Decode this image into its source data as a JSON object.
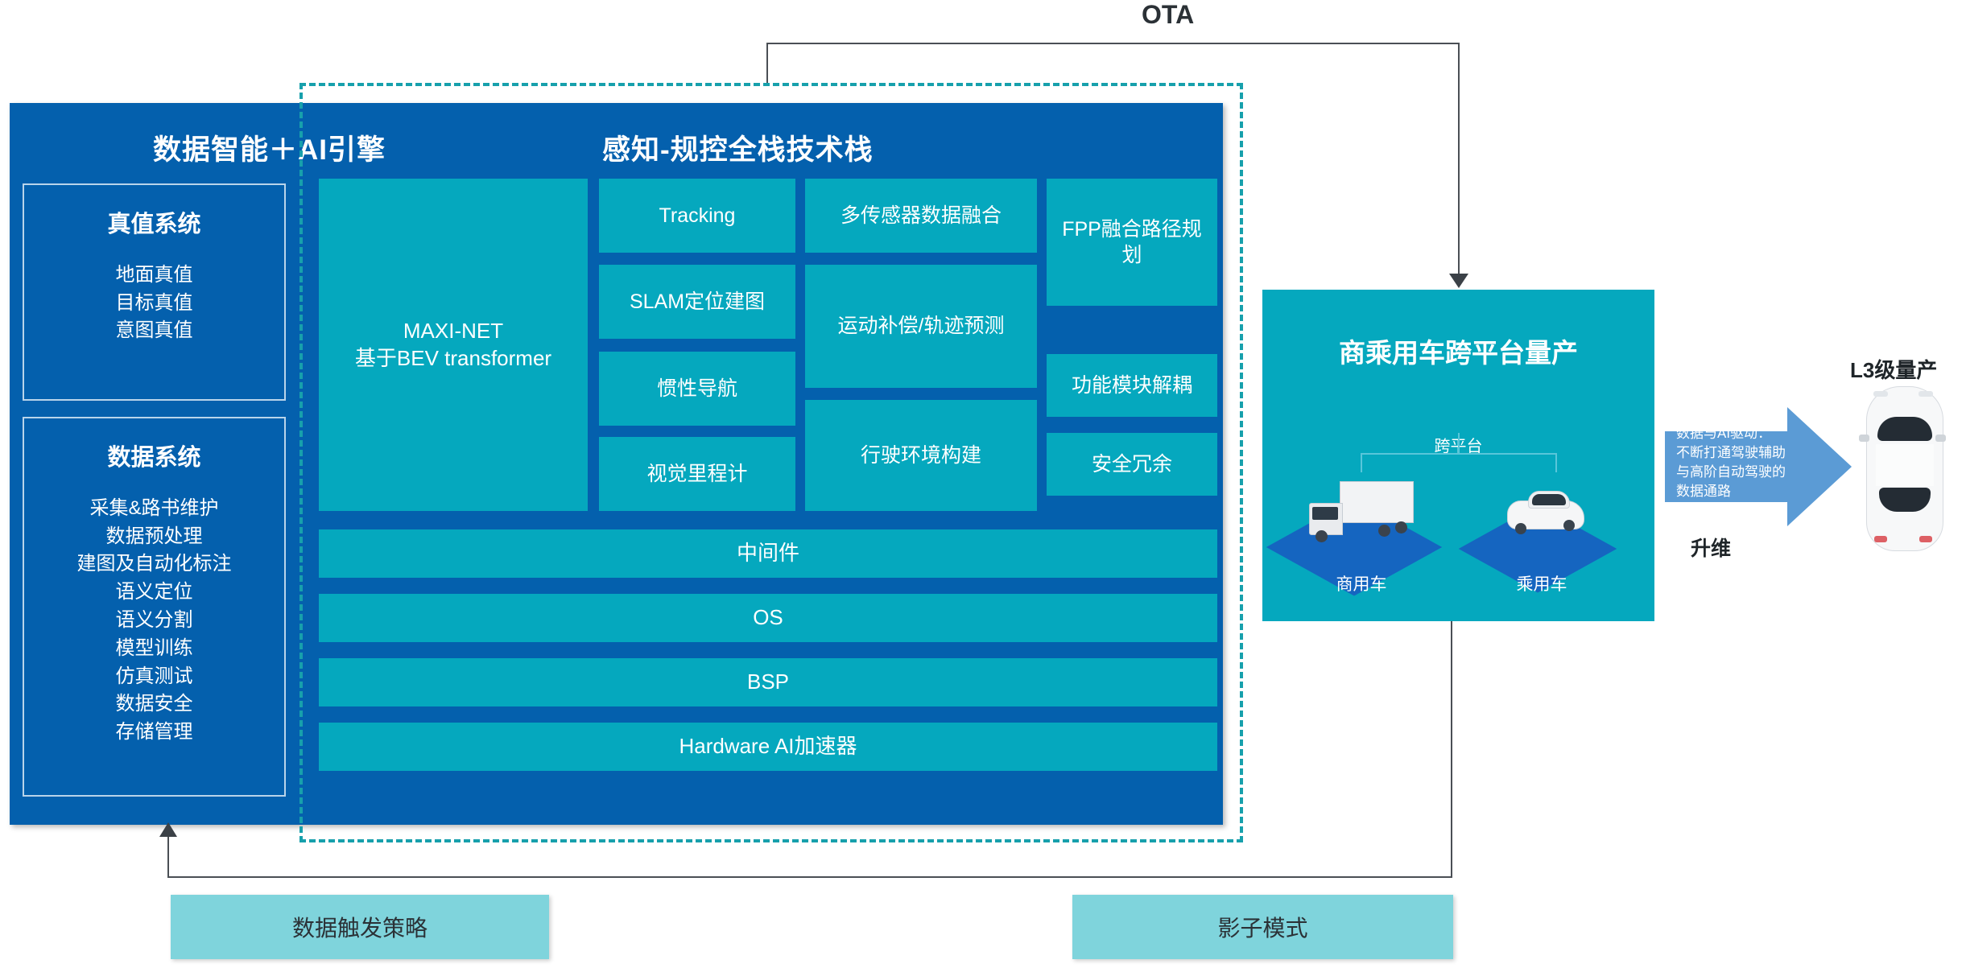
{
  "platform": {
    "heading_data": "数据智能＋AI引擎",
    "heading_stack": "感知-规控全栈技术栈",
    "truth_system": {
      "title": "真值系统",
      "items": [
        "地面真值",
        "目标真值",
        "意图真值"
      ]
    },
    "data_system": {
      "title": "数据系统",
      "items": [
        "采集&路书维护",
        "数据预处理",
        "建图及自动化标注",
        "语义定位",
        "语义分割",
        "模型训练",
        "仿真测试",
        "数据安全",
        "存储管理"
      ]
    },
    "cells": {
      "maxinet": "MAXI-NET\n基于BEV transformer",
      "tracking": "Tracking",
      "slam": "SLAM定位建图",
      "inertial": "惯性导航",
      "visual_odometry": "视觉里程计",
      "sensor_fusion": "多传感器数据融合",
      "motion_compensation": "运动补偿/轨迹预测",
      "driving_environment": "行驶环境构建",
      "fpp_planning": "FPP融合路径规划",
      "module_decoupling": "功能模块解耦",
      "safety_redundancy": "安全冗余"
    },
    "stack_bars": [
      "中间件",
      "OS",
      "BSP",
      "Hardware AI加速器"
    ]
  },
  "cross_platform": {
    "title": "商乘用车跨平台量产",
    "subtitle": "跨平台",
    "vehicles": [
      {
        "caption": "商用车"
      },
      {
        "caption": "乘用车"
      }
    ]
  },
  "right_section": {
    "arrow_text": [
      "数据与AI驱动：",
      "不断打通驾驶辅助",
      "与高阶自动驾驶的",
      "数据通路"
    ],
    "upgrade_label": "升维",
    "l3_label": "L3级量产"
  },
  "connectors": {
    "ota_label": "OTA"
  },
  "bottom": {
    "data_trigger": "数据触发策略",
    "shadow_mode": "影子模式"
  },
  "colors": {
    "deep_blue": "#0460AD",
    "teal": "#05A8BE",
    "dashed_teal": "#17A0AC",
    "light_teal": "#7FD4DC",
    "arrow_blue": "#5B9BD5",
    "line_gray": "#4A4F55",
    "text_dark": "#2B3136"
  }
}
